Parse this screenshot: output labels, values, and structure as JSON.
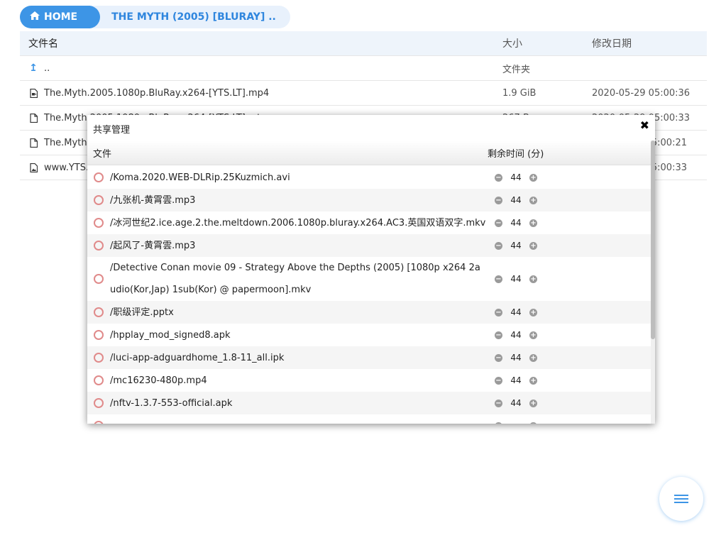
{
  "breadcrumb": {
    "home_label": "HOME",
    "current_label": "THE MYTH (2005) [BLURAY] .."
  },
  "table": {
    "headers": {
      "name": "文件名",
      "size": "大小",
      "date": "修改日期"
    },
    "parent": {
      "name": "..",
      "size": "文件夹"
    },
    "rows": [
      {
        "name": "The.Myth.2005.1080p.BluRay.x264-[YTS.LT].mp4",
        "size": "1.9 GiB",
        "date": "2020-05-29 05:00:36",
        "icon": "video-file-icon"
      },
      {
        "name": "The.Myth.2005.1080p.BluRay.x264-[YTS.LT].srt",
        "size": "267 B",
        "date": "2020-05-29 05:00:33",
        "icon": "file-icon"
      },
      {
        "name": "The.Myth.",
        "size": "",
        "date": "05:00:21",
        "icon": "file-icon"
      },
      {
        "name": "www.YTS.L",
        "size": "",
        "date": "05:00:33",
        "icon": "image-file-icon"
      }
    ]
  },
  "modal": {
    "title": "共享管理",
    "close_icon": "close-icon",
    "col_file": "文件",
    "col_time": "剩余时间 (分)",
    "items": [
      {
        "file": "/Koma.2020.WEB-DLRip.25Kuzmich.avi",
        "minutes": "44"
      },
      {
        "file": "/九张机-黄霄雲.mp3",
        "minutes": "44"
      },
      {
        "file": "/冰河世纪2.ice.age.2.the.meltdown.2006.1080p.bluray.x264.AC3.英国双语双字.mkv",
        "minutes": "44"
      },
      {
        "file": "/起风了-黄霄雲.mp3",
        "minutes": "44"
      },
      {
        "file": "/Detective Conan movie 09 - Strategy Above the Depths (2005) [1080p x264 2audio(Kor,Jap) 1sub(Kor) @ papermoon].mkv",
        "minutes": "44"
      },
      {
        "file": "/职级评定.pptx",
        "minutes": "44"
      },
      {
        "file": "/hpplay_mod_signed8.apk",
        "minutes": "44"
      },
      {
        "file": "/luci-app-adguardhome_1.8-11_all.ipk",
        "minutes": "44"
      },
      {
        "file": "/mc16230-480p.mp4",
        "minutes": "44"
      },
      {
        "file": "/nftv-1.3.7-553-official.apk",
        "minutes": "44"
      },
      {
        "file": "",
        "minutes": ""
      }
    ]
  },
  "fab": {
    "icon": "menu-icon"
  },
  "colors": {
    "accent": "#3d95e6",
    "radio": "#e08a8a"
  }
}
